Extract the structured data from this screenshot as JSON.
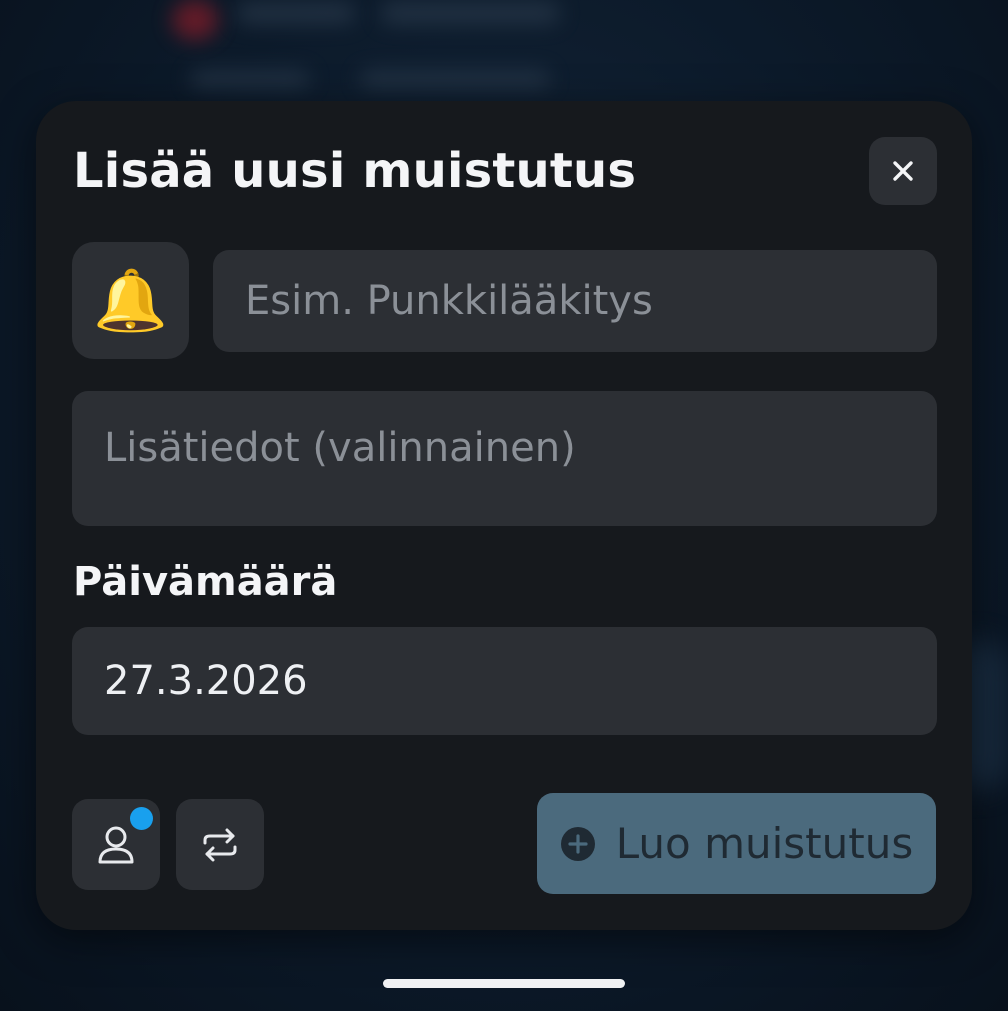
{
  "modal": {
    "title": "Lisää uusi muistutus",
    "close_icon": "close-icon",
    "bell_emoji": "🔔",
    "title_placeholder": "Esim. Punkkilääkitys",
    "details_placeholder": "Lisätiedot (valinnainen)",
    "date_label": "Päivämäärä",
    "date_value": "27.3.2026",
    "assign_icon": "person-icon",
    "repeat_icon": "repeat-icon",
    "create_button_label": "Luo muistutus",
    "create_button_icon": "plus-circle-icon"
  },
  "colors": {
    "modal_bg": "#16191d",
    "field_bg": "#2c2f34",
    "badge": "#19a0ee",
    "create_button_bg": "#4b6a7d"
  }
}
